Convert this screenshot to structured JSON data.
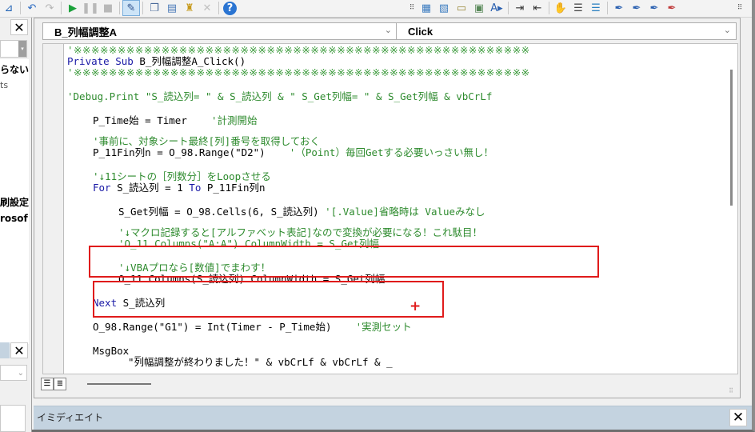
{
  "toolbar": {
    "left_buttons": [
      {
        "name": "insert-module-icon",
        "glyph": "⊿",
        "color": "#1b5fb4"
      },
      {
        "name": "undo-icon",
        "glyph": "↶",
        "color": "#2c6bc2"
      },
      {
        "name": "redo-icon",
        "glyph": "↷",
        "color": "#b5b5b5"
      },
      {
        "name": "run-icon",
        "glyph": "▶",
        "color": "#1aa13a"
      },
      {
        "name": "break-icon",
        "glyph": "❚❚",
        "color": "#b8b8b8"
      },
      {
        "name": "reset-icon",
        "glyph": "■",
        "color": "#b8b8b8"
      },
      {
        "name": "design-mode-icon",
        "glyph": "✎",
        "color": "#2a4e8c"
      },
      {
        "name": "project-explorer-icon",
        "glyph": "❐",
        "color": "#4a6a9a"
      },
      {
        "name": "properties-window-icon",
        "glyph": "▤",
        "color": "#4a7ab8"
      },
      {
        "name": "object-browser-icon",
        "glyph": "♜",
        "color": "#c79a1c"
      },
      {
        "name": "toolbox-icon",
        "glyph": "✕",
        "color": "#c0c0c0"
      },
      {
        "name": "help-icon",
        "glyph": "?",
        "color": "#ffffff",
        "bg": "#2a74d2"
      }
    ],
    "right_buttons": [
      {
        "name": "list-properties-icon",
        "glyph": "▦",
        "color": "#3c7cc0"
      },
      {
        "name": "list-constants-icon",
        "glyph": "▧",
        "color": "#3c7cc0"
      },
      {
        "name": "quick-info-icon",
        "glyph": "▭",
        "color": "#9a8a3a"
      },
      {
        "name": "parameter-info-icon",
        "glyph": "▣",
        "color": "#5a8a5a"
      },
      {
        "name": "complete-word-icon",
        "glyph": "A▸",
        "color": "#2a60b0"
      },
      {
        "name": "indent-icon",
        "glyph": "⇥",
        "color": "#333333"
      },
      {
        "name": "outdent-icon",
        "glyph": "⇤",
        "color": "#333333"
      },
      {
        "name": "toggle-breakpoint-icon",
        "glyph": "✋",
        "color": "#d9a441"
      },
      {
        "name": "comment-block-icon",
        "glyph": "☰",
        "color": "#444444"
      },
      {
        "name": "uncomment-block-icon",
        "glyph": "☰",
        "color": "#2a80c0"
      },
      {
        "name": "toggle-bookmark-icon",
        "glyph": "✒",
        "color": "#2a60b0"
      },
      {
        "name": "next-bookmark-icon",
        "glyph": "✒",
        "color": "#2a60b0"
      },
      {
        "name": "previous-bookmark-icon",
        "glyph": "✒",
        "color": "#2a60b0"
      },
      {
        "name": "clear-bookmarks-icon",
        "glyph": "✒",
        "color": "#c03a3a"
      }
    ]
  },
  "left_pane": {
    "close_label": "✕",
    "items": [
      {
        "text": "らない",
        "style": "bold"
      },
      {
        "text": "ts",
        "style": "gray"
      },
      {
        "text": "刷設定",
        "style": "bold"
      },
      {
        "text": "rosof",
        "style": "bold"
      }
    ],
    "lower_close_label": "✕",
    "lower_combo_chevron": "⌄"
  },
  "code_window": {
    "object_combo": {
      "value": "B_列幅調整A",
      "chevron": "⌄"
    },
    "procedure_combo": {
      "value": "Click",
      "chevron": "⌄"
    },
    "lines": [
      {
        "indent": 0,
        "segments": [
          {
            "t": "'※※※※※※※※※※※※※※※※※※※※※※※※※※※※※※※※※※※※※※※※※※※※※※※※※※※※",
            "c": "stars"
          }
        ]
      },
      {
        "indent": 0,
        "segments": [
          {
            "t": "Private Sub ",
            "c": "kw"
          },
          {
            "t": "B_列幅調整A_Click()",
            "c": "tx"
          }
        ]
      },
      {
        "indent": 0,
        "segments": [
          {
            "t": "'※※※※※※※※※※※※※※※※※※※※※※※※※※※※※※※※※※※※※※※※※※※※※※※※※※※※",
            "c": "stars"
          }
        ]
      },
      {
        "indent": 0,
        "segments": [
          {
            "t": "'Debug.Print \"S_読込列= \" & S_読込列 & \" S_Get列幅= \" & S_Get列幅 & vbCrLf",
            "c": "cm"
          }
        ]
      },
      {
        "indent": 1,
        "segments": [
          {
            "t": "P_Time始 = Timer    ",
            "c": "tx"
          },
          {
            "t": "'計測開始",
            "c": "cm"
          }
        ]
      },
      {
        "indent": 1,
        "segments": [
          {
            "t": "'事前に、対象シート最終[列]番号を取得しておく",
            "c": "cm"
          }
        ]
      },
      {
        "indent": 1,
        "segments": [
          {
            "t": "P_11Fin列n = O_98.Range(\"D2\")    ",
            "c": "tx"
          },
          {
            "t": "'（Point）毎回Getする必要いっさい無し！",
            "c": "cm"
          }
        ]
      },
      {
        "indent": 1,
        "segments": [
          {
            "t": "'↓11シートの［列数分］をLoopさせる",
            "c": "cm"
          }
        ]
      },
      {
        "indent": 1,
        "segments": [
          {
            "t": "For ",
            "c": "kw"
          },
          {
            "t": "S_読込列 = 1 ",
            "c": "tx"
          },
          {
            "t": "To ",
            "c": "kw"
          },
          {
            "t": "P_11Fin列n",
            "c": "tx"
          }
        ]
      },
      {
        "indent": 2,
        "segments": [
          {
            "t": "S_Get列幅 = O_98.Cells(6, S_読込列) ",
            "c": "tx"
          },
          {
            "t": "'[.Value]省略時は Valueみなし",
            "c": "cm"
          }
        ]
      },
      {
        "indent": 2,
        "segments": [
          {
            "t": "'↓マクロ記録すると[アルファベット表記]なので変換が必要になる！これ駄目！",
            "c": "cm"
          }
        ]
      },
      {
        "indent": 2,
        "segments": [
          {
            "t": "'O_11.Columns(\"A:A\").ColumnWidth = S_Get列幅",
            "c": "cm"
          }
        ]
      },
      {
        "indent": 2,
        "segments": [
          {
            "t": "'↓VBAプロなら[数値]でまわす！",
            "c": "cm"
          }
        ]
      },
      {
        "indent": 2,
        "segments": [
          {
            "t": "O_11.Columns(S_読込列).ColumnWidth = S_Get列幅",
            "c": "tx"
          }
        ]
      },
      {
        "indent": 1,
        "segments": [
          {
            "t": "Next ",
            "c": "kw"
          },
          {
            "t": "S_読込列",
            "c": "tx"
          }
        ]
      },
      {
        "indent": 1,
        "segments": [
          {
            "t": "O_98.Range(\"G1\") = Int(Timer - P_Time始)    ",
            "c": "tx"
          },
          {
            "t": "'実測セット",
            "c": "cm"
          }
        ]
      },
      {
        "indent": 1,
        "segments": [
          {
            "t": "MsgBox _",
            "c": "tx"
          }
        ]
      },
      {
        "indent": 2,
        "segments": [
          {
            "t": "\"列幅調整が終わりました！\" & vbCrLf & vbCrLf & _",
            "c": "tx"
          }
        ]
      }
    ],
    "highlight_color": "#e01b1b",
    "cursor_mark": "+",
    "view_buttons": [
      {
        "name": "procedure-view-icon",
        "glyph": "☰"
      },
      {
        "name": "full-module-view-icon",
        "glyph": "≣"
      }
    ]
  },
  "immediate_window": {
    "title": "イミディエイト",
    "close_label": "✕"
  },
  "colors": {
    "keyword": "#1a1aa6",
    "comment": "#2e8b2e",
    "title_bar": "#c4d3e0"
  }
}
